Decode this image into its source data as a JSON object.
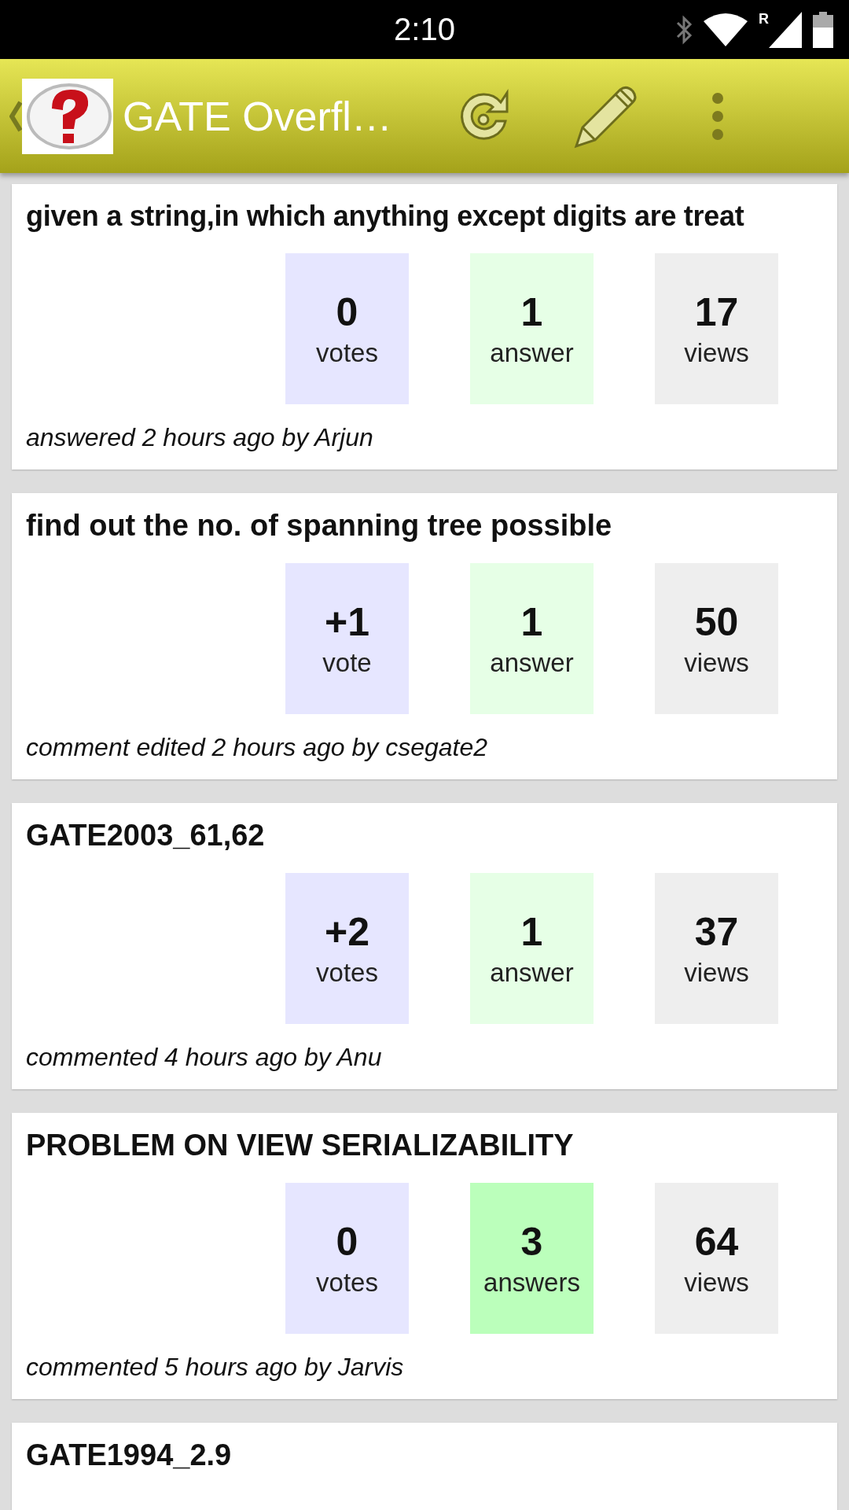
{
  "status_bar": {
    "time": "2:10",
    "roaming": "R"
  },
  "app_bar": {
    "title": "GATE Overfl…"
  },
  "questions": [
    {
      "title": "given a string,in which anything except digits are treat",
      "votes": "0",
      "votes_label": "votes",
      "answers": "1",
      "answers_label": "answer",
      "accepted": false,
      "views": "17",
      "views_label": "views",
      "meta": "answered 2 hours ago by Arjun"
    },
    {
      "title": "find out the no. of spanning tree possible",
      "votes": "+1",
      "votes_label": "vote",
      "answers": "1",
      "answers_label": "answer",
      "accepted": false,
      "views": "50",
      "views_label": "views",
      "meta": "comment edited 2 hours ago by csegate2"
    },
    {
      "title": "GATE2003_61,62",
      "votes": "+2",
      "votes_label": "votes",
      "answers": "1",
      "answers_label": "answer",
      "accepted": false,
      "views": "37",
      "views_label": "views",
      "meta": "commented 4 hours ago by Anu"
    },
    {
      "title": "PROBLEM ON VIEW SERIALIZABILITY",
      "votes": "0",
      "votes_label": "votes",
      "answers": "3",
      "answers_label": "answers",
      "accepted": true,
      "views": "64",
      "views_label": "views",
      "meta": "commented 5 hours ago by Jarvis"
    },
    {
      "title": "GATE1994_2.9"
    }
  ]
}
